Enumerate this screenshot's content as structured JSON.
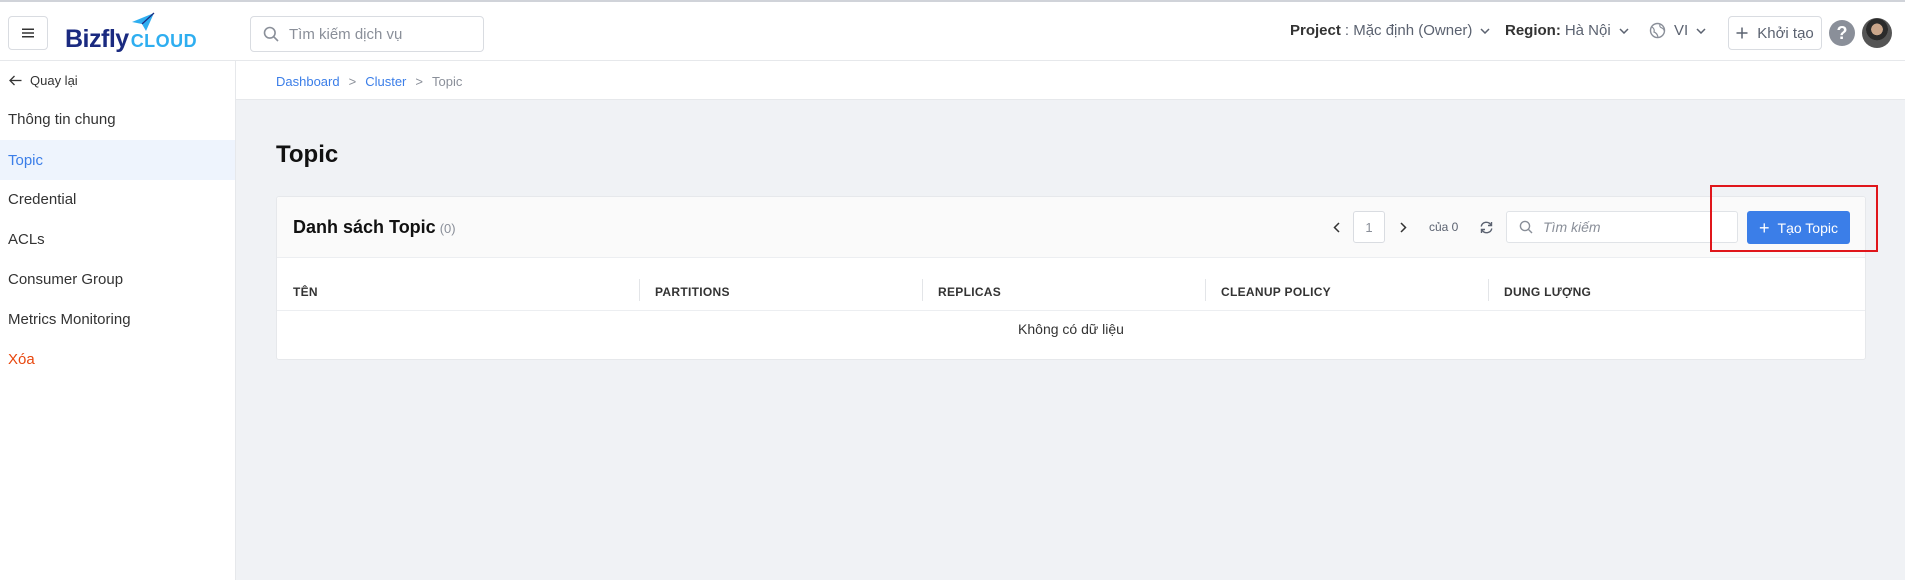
{
  "header": {
    "logo_text": "Bizfly",
    "logo_sub": "CLOUD",
    "search_placeholder": "Tìm kiếm dịch vụ",
    "project_label": "Project",
    "project_value": ": Mặc định (Owner)",
    "region_label": "Region:",
    "region_value": "Hà Nội",
    "language": "VI",
    "create_label": "Khởi tạo",
    "help": "?"
  },
  "sidebar": {
    "back_label": "Quay lại",
    "items": [
      {
        "label": "Thông tin chung"
      },
      {
        "label": "Topic"
      },
      {
        "label": "Credential"
      },
      {
        "label": "ACLs"
      },
      {
        "label": "Consumer Group"
      },
      {
        "label": "Metrics Monitoring"
      },
      {
        "label": "Xóa"
      }
    ]
  },
  "breadcrumb": {
    "items": [
      "Dashboard",
      "Cluster",
      "Topic"
    ],
    "separator": ">"
  },
  "page": {
    "title": "Topic"
  },
  "list": {
    "title": "Danh sách Topic",
    "count": "(0)",
    "pagination": {
      "current_page": "1",
      "of_text": "của 0"
    },
    "search_placeholder": "Tìm kiếm",
    "create_button": "Tạo Topic",
    "columns": [
      "TÊN",
      "PARTITIONS",
      "REPLICAS",
      "CLEANUP POLICY",
      "DUNG LƯỢNG"
    ],
    "empty_text": "Không có dữ liệu"
  },
  "colors": {
    "primary": "#3b7ee8",
    "danger": "#e8470e",
    "highlight": "#e0161b",
    "logo_dark": "#1a2a80",
    "logo_light": "#2eaef0"
  }
}
